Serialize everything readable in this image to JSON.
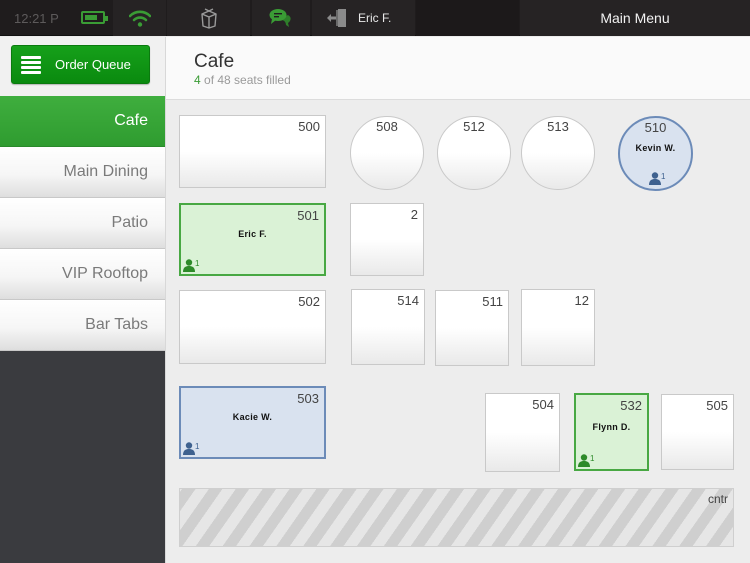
{
  "status_bar": {
    "time": "12:21 P",
    "battery_icon": "battery-icon",
    "wifi_icon": "wifi-icon"
  },
  "toolbar": {
    "box_icon": "takeout-box-icon",
    "chat_icon": "chat-bubbles-icon",
    "logout_icon": "logout-door-icon",
    "user_name": "Eric F.",
    "main_menu_label": "Main Menu"
  },
  "sidebar": {
    "order_queue_label": "Order Queue",
    "items": [
      {
        "label": "Cafe",
        "active": true
      },
      {
        "label": "Main Dining",
        "active": false
      },
      {
        "label": "Patio",
        "active": false
      },
      {
        "label": "VIP Rooftop",
        "active": false
      },
      {
        "label": "Bar Tabs",
        "active": false
      }
    ]
  },
  "header": {
    "title": "Cafe",
    "seats_filled": "4",
    "seats_text": " of 48 seats filled"
  },
  "colors": {
    "brand_green": "#2f9c30",
    "occupied_green": "#48a843",
    "occupied_blue": "#6c8bb8",
    "topbar": "#1f1c1d"
  },
  "tables": [
    {
      "number": "500",
      "shape": "rect",
      "status": "empty",
      "guest": "",
      "seats": ""
    },
    {
      "number": "508",
      "shape": "round",
      "status": "empty",
      "guest": "",
      "seats": ""
    },
    {
      "number": "512",
      "shape": "round",
      "status": "empty",
      "guest": "",
      "seats": ""
    },
    {
      "number": "513",
      "shape": "round",
      "status": "empty",
      "guest": "",
      "seats": ""
    },
    {
      "number": "510",
      "shape": "round",
      "status": "blue",
      "guest": "Kevin W.",
      "seats": "1"
    },
    {
      "number": "501",
      "shape": "rect",
      "status": "green",
      "guest": "Eric F.",
      "seats": "1"
    },
    {
      "number": "2",
      "shape": "square",
      "status": "empty",
      "guest": "",
      "seats": ""
    },
    {
      "number": "502",
      "shape": "rect",
      "status": "empty",
      "guest": "",
      "seats": ""
    },
    {
      "number": "514",
      "shape": "square",
      "status": "empty",
      "guest": "",
      "seats": ""
    },
    {
      "number": "511",
      "shape": "square",
      "status": "empty",
      "guest": "",
      "seats": ""
    },
    {
      "number": "12",
      "shape": "square",
      "status": "empty",
      "guest": "",
      "seats": ""
    },
    {
      "number": "503",
      "shape": "rect",
      "status": "blue",
      "guest": "Kacie W.",
      "seats": "1"
    },
    {
      "number": "504",
      "shape": "square",
      "status": "empty",
      "guest": "",
      "seats": ""
    },
    {
      "number": "532",
      "shape": "square",
      "status": "green",
      "guest": "Flynn D.",
      "seats": "1"
    },
    {
      "number": "505",
      "shape": "square",
      "status": "empty",
      "guest": "",
      "seats": ""
    }
  ],
  "counter": {
    "label": "cntr"
  }
}
